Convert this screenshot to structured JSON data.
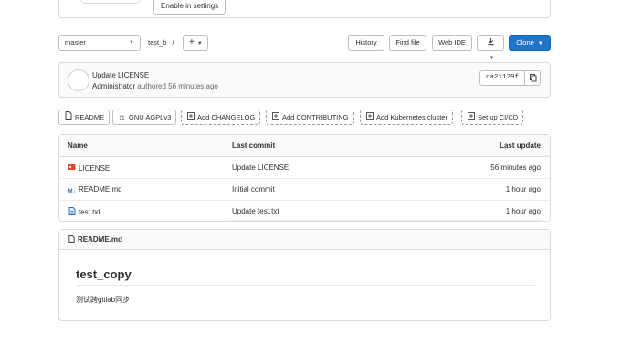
{
  "banner": {
    "enable_label": "Enable in settings"
  },
  "toolbar": {
    "branch": "master",
    "path": "test_b",
    "path_sep": "/",
    "add_label": "+",
    "history": "History",
    "find_file": "Find file",
    "web_ide": "Web IDE",
    "clone": "Clone"
  },
  "commit": {
    "title": "Update LICENSE",
    "author": "Administrator",
    "authored_text": "authored 56 minutes ago",
    "sha": "da21129f"
  },
  "quick_links": [
    {
      "label": "README",
      "icon": "document-icon",
      "style": "solid"
    },
    {
      "label": "GNU AGPLv3",
      "icon": "scale-icon",
      "style": "solid"
    },
    {
      "label": "Add CHANGELOG",
      "icon": "plus-icon",
      "style": "dashed"
    },
    {
      "label": "Add CONTRIBUTING",
      "icon": "plus-icon",
      "style": "dashed"
    },
    {
      "label": "Add Kubernetes cluster",
      "icon": "plus-icon",
      "style": "dashed"
    },
    {
      "label": "Set up CI/CD",
      "icon": "plus-icon",
      "style": "dashed"
    }
  ],
  "files": {
    "headers": {
      "name": "Name",
      "last_commit": "Last commit",
      "last_update": "Last update"
    },
    "rows": [
      {
        "name": "LICENSE",
        "icon": "license-icon",
        "icon_color": "#e24329",
        "commit": "Update LICENSE",
        "updated": "56 minutes ago"
      },
      {
        "name": "README.md",
        "icon": "markdown-icon",
        "icon_color": "#1f75cb",
        "commit": "Initial commit",
        "updated": "1 hour ago"
      },
      {
        "name": "test.txt",
        "icon": "text-file-icon",
        "icon_color": "#1f75cb",
        "commit": "Update test.txt",
        "updated": "1 hour ago"
      }
    ]
  },
  "readme": {
    "filename": "README.md",
    "heading": "test_copy",
    "body": "测试跨gitlab同步"
  },
  "colors": {
    "primary": "#1f75cb",
    "border": "#dbdbdb",
    "header_bg": "#fafafa"
  }
}
